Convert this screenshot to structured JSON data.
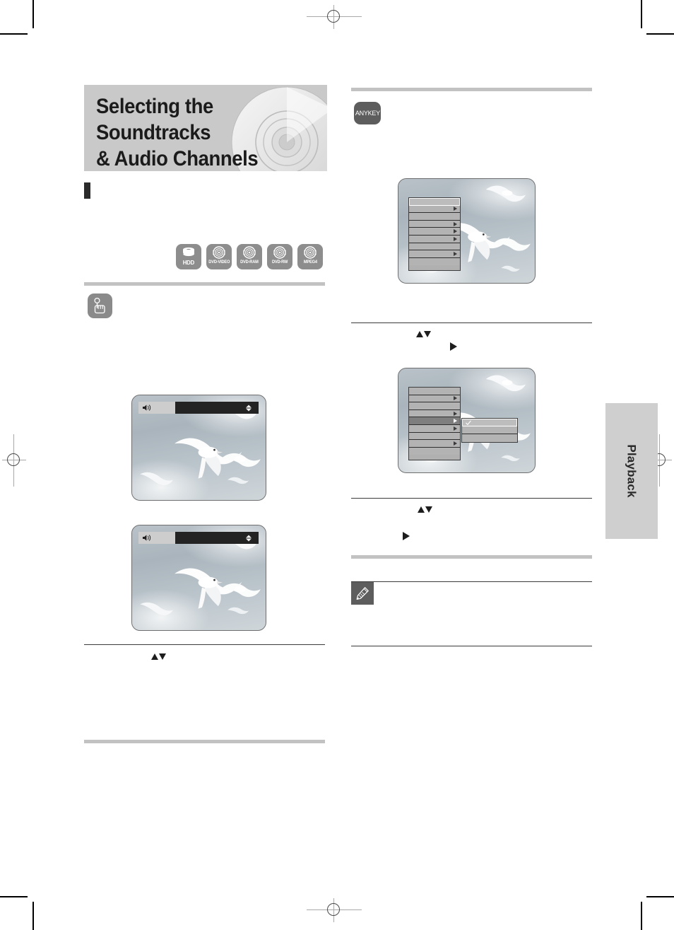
{
  "document": {
    "section_title_line1": "Selecting the Soundtracks",
    "section_title_line2": "& Audio Channels",
    "side_tab_label": "Playback"
  },
  "media_badges": [
    {
      "label": "HDD",
      "icon": "hdd-stack-icon"
    },
    {
      "label": "DVD-VIDEO",
      "icon": "disc-icon"
    },
    {
      "label": "DVD-RAM",
      "icon": "disc-icon"
    },
    {
      "label": "DVD-RW",
      "icon": "disc-icon"
    },
    {
      "label": "MPEG4",
      "icon": "disc-icon"
    }
  ],
  "left_column": {
    "step_badge": {
      "label": "",
      "icon": "hand-press-button-icon"
    },
    "screens": [
      {
        "name": "audio-osd-screen-1",
        "osd": {
          "icon": "speaker-icon",
          "label": "",
          "value": "",
          "stepper": "up-down-arrows"
        }
      },
      {
        "name": "audio-osd-screen-2",
        "osd": {
          "icon": "speaker-icon",
          "label": "",
          "value": "",
          "stepper": "up-down-arrows"
        }
      }
    ],
    "nav_glyph": "up-down-triangles"
  },
  "right_column": {
    "anykey_badge": {
      "label": "ANYKEY"
    },
    "screens": [
      {
        "name": "anykey-menu-screen",
        "menu": {
          "rows": [
            {
              "selected": true,
              "arrow": false
            },
            {
              "selected": false,
              "arrow": true
            },
            {
              "selected": false,
              "arrow": false
            },
            {
              "selected": false,
              "arrow": true
            },
            {
              "selected": false,
              "arrow": true
            },
            {
              "selected": false,
              "arrow": true
            },
            {
              "selected": false,
              "arrow": false
            },
            {
              "selected": false,
              "arrow": true
            },
            {
              "selected": false,
              "arrow": false
            }
          ]
        }
      },
      {
        "name": "anykey-submenu-screen",
        "menu": {
          "rows": [
            {
              "selected": false,
              "arrow": false,
              "active": false
            },
            {
              "selected": false,
              "arrow": true,
              "active": false
            },
            {
              "selected": false,
              "arrow": false,
              "active": false
            },
            {
              "selected": false,
              "arrow": true,
              "active": false
            },
            {
              "selected": false,
              "arrow": true,
              "active": true
            },
            {
              "selected": false,
              "arrow": true,
              "active": false
            },
            {
              "selected": false,
              "arrow": false,
              "active": false
            },
            {
              "selected": false,
              "arrow": true,
              "active": false
            },
            {
              "selected": false,
              "arrow": false,
              "active": false
            }
          ],
          "submenu": {
            "rows": [
              {
                "selected": true,
                "checked": true
              },
              {
                "selected": false,
                "checked": false
              },
              {
                "selected": false,
                "checked": false
              }
            ]
          }
        }
      }
    ],
    "nav_glyph_updown": "up-down-triangles",
    "nav_glyph_right": "right-triangle",
    "note_badge": {
      "icon": "pencil-note-icon"
    }
  }
}
